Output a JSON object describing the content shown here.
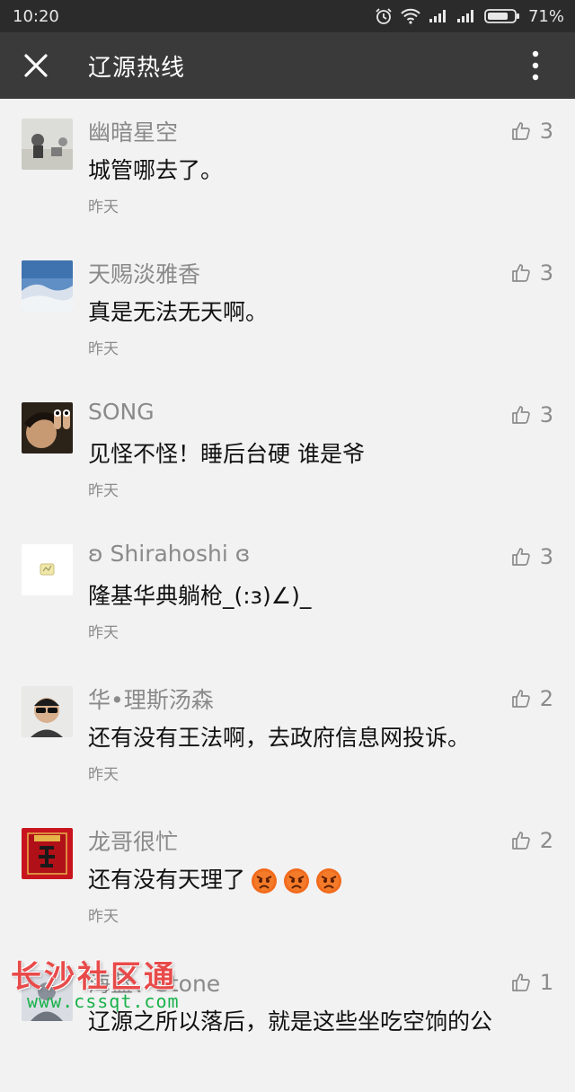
{
  "status_bar": {
    "time": "10:20",
    "battery": "71%"
  },
  "header": {
    "title": "辽源热线"
  },
  "comments": [
    {
      "name": "幽暗星空",
      "text": "城管哪去了。",
      "time": "昨天",
      "likes": "3"
    },
    {
      "name": "天赐淡雅香",
      "text": "真是无法无天啊。",
      "time": "昨天",
      "likes": "3"
    },
    {
      "name": "SONG",
      "text": "见怪不怪！睡后台硬 谁是爷",
      "time": "昨天",
      "likes": "3"
    },
    {
      "name": "ʚ  Shirahoshi  ɞ",
      "text": "隆基华典躺枪_(:з)∠)_",
      "time": "昨天",
      "likes": "3"
    },
    {
      "name": "华•理斯汤森",
      "text": "还有没有王法啊，去政府信息网投诉。",
      "time": "昨天",
      "likes": "2"
    },
    {
      "name": "龙哥很忙",
      "text": "还有没有天理了",
      "time": "昨天",
      "likes": "2",
      "emojis": [
        "angry-face",
        "angry-face",
        "angry-face"
      ]
    },
    {
      "name": "海蓝、Stone",
      "text": "辽源之所以落后，就是这些坐吃空饷的公",
      "likes": "1"
    }
  ],
  "watermark": {
    "top": "长沙社区通",
    "bottom": "www.cssqt.com"
  },
  "colors": {
    "status_bar": "#2b2b2b",
    "title_bar": "#3a3a3a",
    "background": "#f2f2f2",
    "name": "#8a8a8a",
    "watermark_red": "#e84a4a",
    "watermark_green": "#19b24a"
  }
}
